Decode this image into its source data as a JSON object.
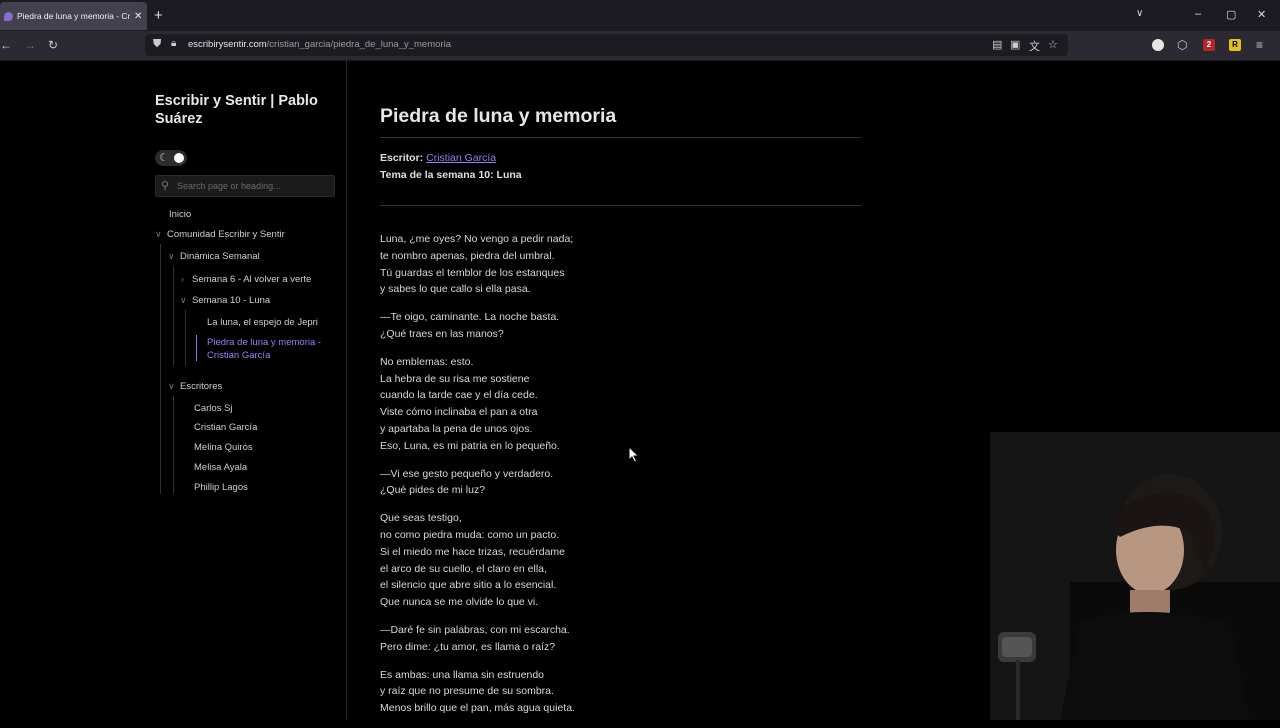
{
  "browser": {
    "tab_title": "Piedra de luna y memoria - Cristian García",
    "tab_close": "✕",
    "new_tab": "+",
    "url_domain": "escribirysentir.com",
    "url_path": "/cristian_garcia/piedra_de_luna_y_memoria",
    "extension_badge": "2",
    "extension_r_label": "R"
  },
  "sidebar": {
    "site_title": "Escribir y Sentir | Pablo Suárez",
    "search_placeholder": "Search page or heading...",
    "nav": {
      "inicio": "Inicio",
      "comunidad": "Comunidad Escribir y Sentir",
      "dinamica": "Dinámica Semanal",
      "semana6": "Semana 6 - Al volver a verte",
      "semana10": "Semana 10 - Luna",
      "luna_espejo": "La luna, el espejo de Jepri",
      "piedra": "Piedra de luna y memoria - Cristian García",
      "escritores": "Escritores",
      "writers": [
        "Carlos Sj",
        "Cristian García",
        "Melina Quirós",
        "Melisa Ayala",
        "Phillip Lagos"
      ]
    }
  },
  "article": {
    "title": "Piedra de luna y memoria",
    "writer_label": "Escritor:",
    "writer_name": "Cristian García",
    "theme": "Tema de la semana 10: Luna",
    "stanzas": [
      [
        "Luna, ¿me oyes? No vengo a pedir nada;",
        "te nombro apenas, piedra del umbral.",
        "Tú guardas el temblor de los estanques",
        "y sabes lo que callo si ella pasa."
      ],
      [
        "—Te oigo, caminante. La noche basta.",
        "¿Qué traes en las manos?"
      ],
      [
        "No emblemas: esto.",
        "La hebra de su risa me sostiene",
        "cuando la tarde cae y el día cede.",
        "Viste cómo inclinaba el pan a otra",
        "y apartaba la pena de unos ojos.",
        "Eso, Luna, es mi patria en lo pequeño."
      ],
      [
        "—Vi ese gesto pequeño y verdadero.",
        "¿Qué pides de mi luz?"
      ],
      [
        "Que seas testigo,",
        "no como piedra muda: como un pacto.",
        "Si el miedo me hace trizas, recuérdame",
        "el arco de su cuello, el claro en ella,",
        "el silencio que abre sitio a lo esencial.",
        "Que nunca se me olvide lo que vi."
      ],
      [
        "—Daré fe sin palabras, con mi escarcha.",
        "Pero dime: ¿tu amor, es llama o raíz?"
      ],
      [
        "Es ambas: una llama sin estruendo",
        "y raíz que no presume de su sombra.",
        "Menos brillo que el pan, más agua quieta."
      ]
    ]
  }
}
